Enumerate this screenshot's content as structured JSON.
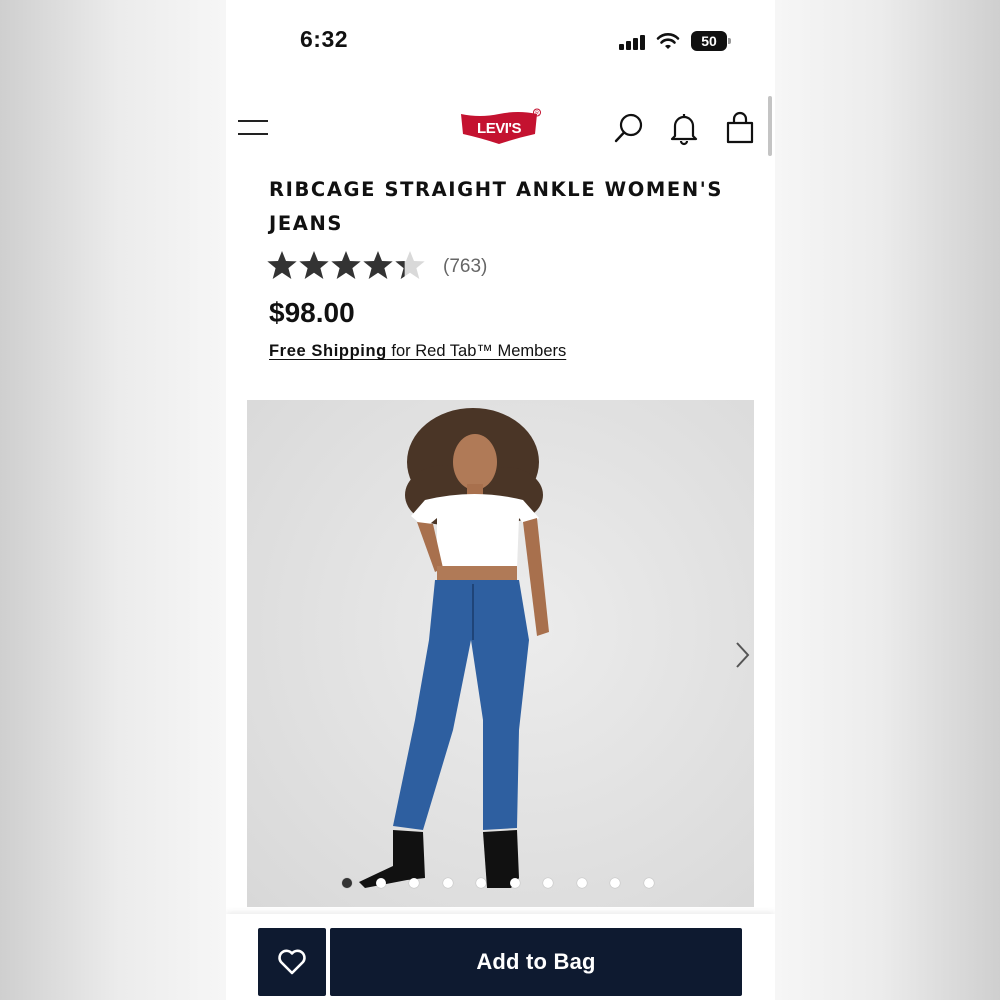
{
  "status_bar": {
    "time": "6:32",
    "battery": "50",
    "icons": [
      "cellular-signal-icon",
      "wifi-icon",
      "battery-icon"
    ]
  },
  "header": {
    "logo_text": "Levi's",
    "icons": [
      "menu-icon",
      "search-icon",
      "bell-icon",
      "shopping-bag-icon"
    ],
    "colors": {
      "logo_red": "#c41230"
    }
  },
  "product": {
    "title": "RIBCAGE STRAIGHT ANKLE WOMEN'S JEANS",
    "rating": 4.3,
    "rating_max": 5,
    "review_count": "(763)",
    "price": "$98.00",
    "shipping_bold": "Free Shipping",
    "shipping_rest": " for Red Tab™ Members"
  },
  "gallery": {
    "image_count": 10,
    "active_index": 0,
    "next_icon": "chevron-right-icon"
  },
  "actions": {
    "wishlist_icon": "heart-icon",
    "add_to_bag_label": "Add to Bag",
    "button_color": "#0e1a30"
  }
}
